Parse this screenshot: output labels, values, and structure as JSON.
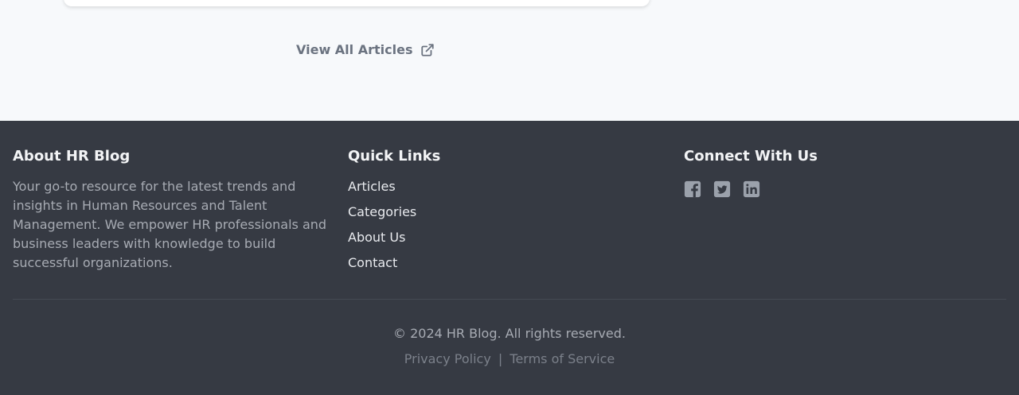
{
  "top": {
    "view_all_label": "View All Articles",
    "view_all_icon": "external-link-icon"
  },
  "footer": {
    "about": {
      "heading": "About HR Blog",
      "text": "Your go-to resource for the latest trends and insights in Human Resources and Talent Management. We empower HR professionals and business leaders with knowledge to build successful organizations."
    },
    "quick_links": {
      "heading": "Quick Links",
      "items": [
        {
          "label": "Articles"
        },
        {
          "label": "Categories"
        },
        {
          "label": "About Us"
        },
        {
          "label": "Contact"
        }
      ]
    },
    "connect": {
      "heading": "Connect With Us",
      "icons": [
        "facebook-icon",
        "twitter-icon",
        "linkedin-icon"
      ]
    },
    "copyright": "© 2024 HR Blog. All rights reserved.",
    "legal": {
      "privacy": "Privacy Policy",
      "separator": "|",
      "terms": "Terms of Service"
    }
  },
  "colors": {
    "page_bg": "#f7f9fb",
    "footer_bg": "#363a43",
    "muted_text": "#a7abb3",
    "link_text": "#6b7380"
  }
}
